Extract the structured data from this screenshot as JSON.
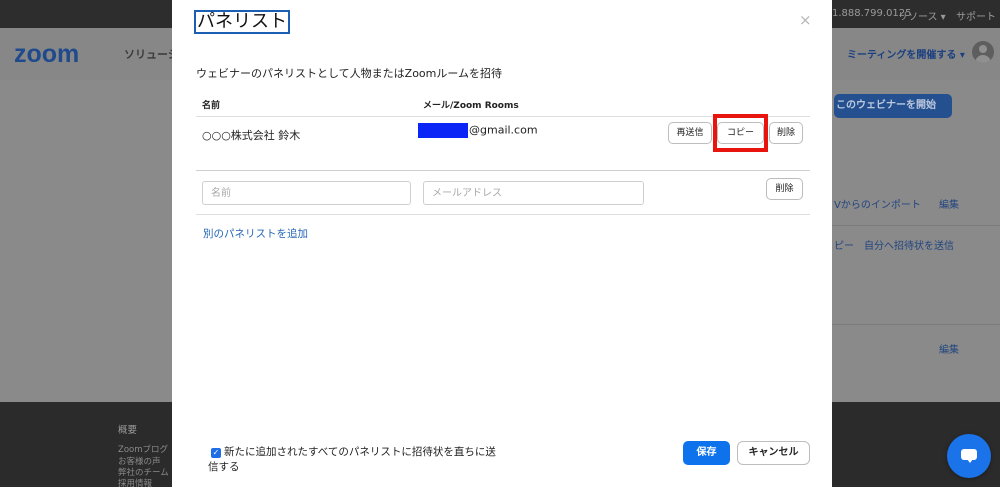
{
  "background": {
    "topbar": {
      "phone": "1.888.799.0125",
      "resources": "リソース ▾",
      "support": "サポート"
    },
    "logo": "zoom",
    "nav": "ソリューシ",
    "host_meeting": "ミーティングを開催する ▾",
    "start_webinar": "このウェビナーを開始",
    "links": {
      "import": "Vからのインポート",
      "edit1": "編集",
      "send_self": "ピー　自分へ招待状を送信",
      "edit2": "編集"
    },
    "footer": [
      "概要",
      "Zoomブログ",
      "お客様の声",
      "弊社のチーム",
      "採用情報"
    ]
  },
  "modal": {
    "title": "パネリスト",
    "close": "×",
    "subtitle": "ウェビナーのパネリストとして人物またはZoomルームを招待",
    "columns": {
      "name": "名前",
      "email": "メール/Zoom Rooms"
    },
    "panelist": {
      "name": "○○○株式会社 鈴木",
      "email_suffix": "@gmail.com"
    },
    "row_buttons": {
      "resend": "再送信",
      "copy": "コピー",
      "delete": "削除"
    },
    "new_row": {
      "name_placeholder": "名前",
      "email_placeholder": "メールアドレス",
      "delete": "削除"
    },
    "add_panelist": "別のパネリストを追加",
    "checkbox_label": "新たに追加されたすべてのパネリストに招待状を直ちに送信する",
    "checkbox_checked": true,
    "save": "保存",
    "cancel": "キャンセル"
  },
  "colors": {
    "primary": "#0e72ed",
    "highlight": "#e8140e",
    "redaction": "#0a25f5"
  }
}
